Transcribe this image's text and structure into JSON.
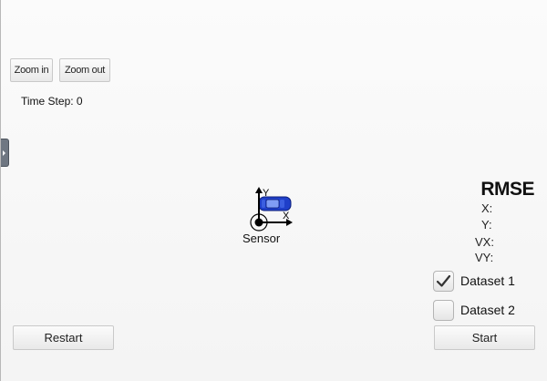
{
  "toolbar": {
    "zoom_in_label": "Zoom in",
    "zoom_out_label": "Zoom out"
  },
  "status": {
    "time_step_label": "Time Step: 0"
  },
  "scene": {
    "sensor_label": "Sensor",
    "axis_x_label": "X",
    "axis_y_label": "Y",
    "car_color": "#1f3fc9"
  },
  "rmse": {
    "title": "RMSE",
    "x_label": "X:",
    "y_label": "Y:",
    "vx_label": "VX:",
    "vy_label": "VY:"
  },
  "datasets": [
    {
      "label": "Dataset 1",
      "checked": true
    },
    {
      "label": "Dataset 2",
      "checked": false
    }
  ],
  "controls": {
    "restart_label": "Restart",
    "start_label": "Start"
  }
}
